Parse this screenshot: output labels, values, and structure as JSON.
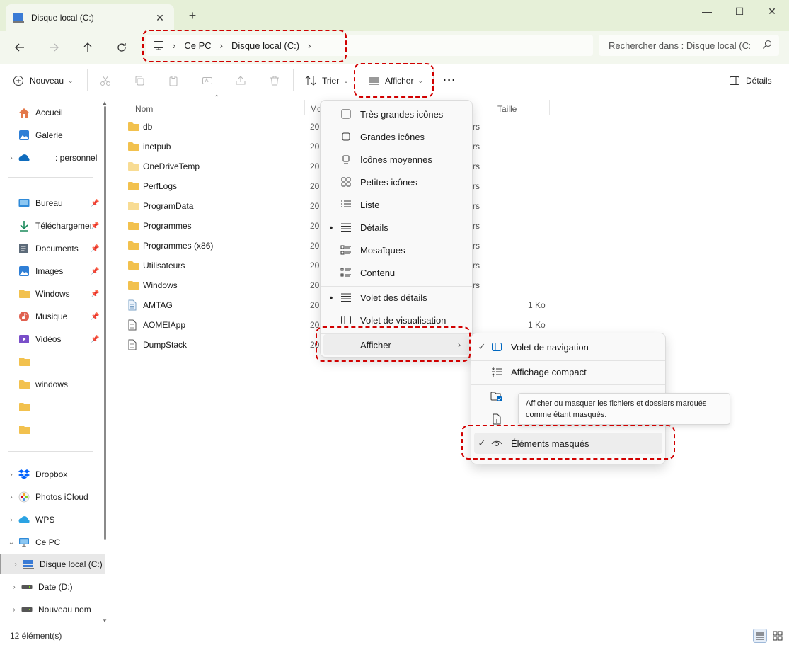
{
  "window": {
    "tab_title": "Disque local (C:)",
    "new_tab": "+",
    "minimize": "—",
    "maximize": "☐",
    "close": "✕"
  },
  "address": {
    "crumbs": [
      "Ce PC",
      "Disque local (C:)"
    ],
    "sep": "›",
    "search_placeholder": "Rechercher dans : Disque local (C:)"
  },
  "toolbar": {
    "new_label": "Nouveau",
    "sort_label": "Trier",
    "view_label": "Afficher",
    "more": "···",
    "details_label": "Détails"
  },
  "sidebar": {
    "items": [
      {
        "label": "Accueil",
        "icon": "home-icon"
      },
      {
        "label": "Galerie",
        "icon": "gallery-icon"
      },
      {
        "label": ": personnel",
        "icon": "onedrive-icon"
      },
      {
        "label": "Bureau",
        "icon": "desktop-icon"
      },
      {
        "label": "Téléchargements",
        "icon": "download-icon"
      },
      {
        "label": "Documents",
        "icon": "documents-icon"
      },
      {
        "label": "Images",
        "icon": "images-icon"
      },
      {
        "label": "Windows",
        "icon": "folder-icon"
      },
      {
        "label": "Musique",
        "icon": "music-icon"
      },
      {
        "label": "Vidéos",
        "icon": "videos-icon"
      },
      {
        "label": "",
        "icon": "folder-icon"
      },
      {
        "label": "windows",
        "icon": "folder-icon"
      },
      {
        "label": "",
        "icon": "folder-icon"
      },
      {
        "label": "",
        "icon": "folder-icon"
      },
      {
        "label": "Dropbox",
        "icon": "dropbox-icon"
      },
      {
        "label": "Photos iCloud",
        "icon": "icloud-photos-icon"
      },
      {
        "label": "WPS",
        "icon": "wps-cloud-icon"
      },
      {
        "label": "Ce PC",
        "icon": "pc-icon"
      },
      {
        "label": "Disque local (C:)",
        "icon": "drive-c-icon"
      },
      {
        "label": "Date (D:)",
        "icon": "drive-icon"
      },
      {
        "label": "Nouveau nom",
        "icon": "drive-icon"
      }
    ]
  },
  "filelist": {
    "columns": [
      "Nom",
      "Mo",
      "Taille"
    ],
    "files": [
      {
        "name": "db",
        "date": "20",
        "type": "rs",
        "size": ""
      },
      {
        "name": "inetpub",
        "date": "20",
        "type": "rs",
        "size": ""
      },
      {
        "name": "OneDriveTemp",
        "date": "20",
        "type": "rs",
        "size": ""
      },
      {
        "name": "PerfLogs",
        "date": "20",
        "type": "rs",
        "size": ""
      },
      {
        "name": "ProgramData",
        "date": "20",
        "type": "rs",
        "size": ""
      },
      {
        "name": "Programmes",
        "date": "20",
        "type": "rs",
        "size": ""
      },
      {
        "name": "Programmes (x86)",
        "date": "20",
        "type": "rs",
        "size": ""
      },
      {
        "name": "Utilisateurs",
        "date": "20",
        "type": "rs",
        "size": ""
      },
      {
        "name": "Windows",
        "date": "20",
        "type": "rs",
        "size": ""
      },
      {
        "name": "AMTAG",
        "date": "20",
        "type": "",
        "size": "1 Ko"
      },
      {
        "name": "AOMEIApp",
        "date": "20",
        "type": "",
        "size": "1 Ko"
      },
      {
        "name": "DumpStack",
        "date": "20",
        "type": "",
        "size": ""
      }
    ]
  },
  "view_menu": {
    "items": [
      {
        "label": "Très grandes icônes",
        "icon": "extra-large-icons-icon",
        "selected": false
      },
      {
        "label": "Grandes icônes",
        "icon": "large-icons-icon",
        "selected": false
      },
      {
        "label": "Icônes moyennes",
        "icon": "medium-icons-icon",
        "selected": false
      },
      {
        "label": "Petites icônes",
        "icon": "small-icons-icon",
        "selected": false
      },
      {
        "label": "Liste",
        "icon": "list-icon",
        "selected": false
      },
      {
        "label": "Détails",
        "icon": "details-icon",
        "selected": true
      },
      {
        "label": "Mosaïques",
        "icon": "tiles-icon",
        "selected": false
      },
      {
        "label": "Contenu",
        "icon": "content-icon",
        "selected": false
      },
      {
        "label": "Volet des détails",
        "icon": "details-pane-icon",
        "selected": true
      },
      {
        "label": "Volet de visualisation",
        "icon": "preview-pane-icon",
        "selected": false
      },
      {
        "label": "Afficher",
        "icon": "",
        "selected": false
      }
    ],
    "bullet": "•",
    "chevron": "›"
  },
  "show_submenu": {
    "items": [
      {
        "label": "Volet de navigation",
        "icon": "nav-pane-icon",
        "checked": true
      },
      {
        "label": "Affichage compact",
        "icon": "compact-icon",
        "checked": false
      },
      {
        "label": "Éléments masqués",
        "icon": "eye-icon",
        "checked": true
      }
    ],
    "check": "✓"
  },
  "tooltip": {
    "text": "Afficher ou masquer les fichiers et dossiers marqués comme étant masqués."
  },
  "status": {
    "count": "12 élément(s)"
  },
  "colors": {
    "titlebar": "#e6f0d8",
    "navbar": "#f3f7ee",
    "folder": "#f2c14e",
    "accent": "#0067c0",
    "annotation": "#d10000"
  }
}
